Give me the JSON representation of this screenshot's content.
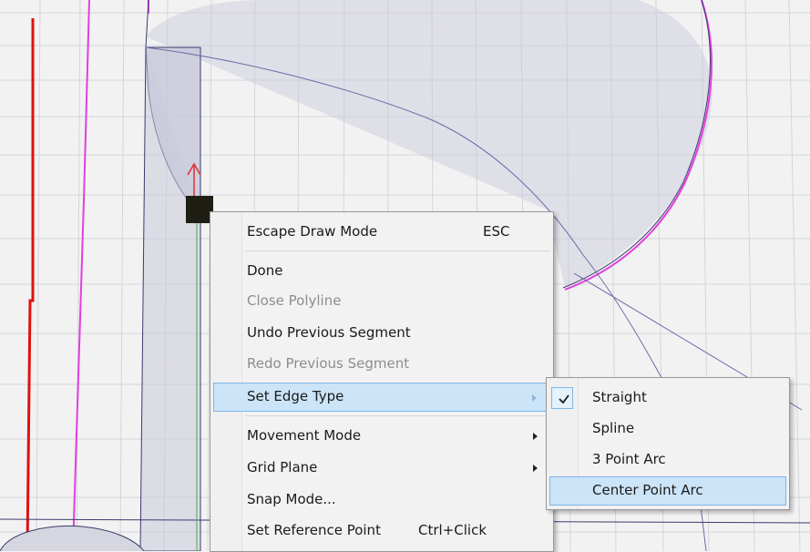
{
  "context_menu": {
    "items": [
      {
        "label": "Escape Draw Mode",
        "shortcut": "ESC"
      },
      {
        "label": "Done"
      },
      {
        "label": "Close Polyline",
        "disabled": true
      },
      {
        "label": "Undo Previous Segment"
      },
      {
        "label": "Redo Previous Segment",
        "disabled": true
      },
      {
        "label": "Set Edge Type",
        "highlighted": true,
        "submenu": true
      },
      {
        "label": "Movement Mode",
        "submenu": true
      },
      {
        "label": "Grid Plane",
        "submenu": true
      },
      {
        "label": "Snap Mode..."
      },
      {
        "label": "Set Reference Point",
        "shortcut": "Ctrl+Click"
      }
    ]
  },
  "submenu": {
    "items": [
      {
        "label": "Straight",
        "checked": true
      },
      {
        "label": "Spline"
      },
      {
        "label": "3 Point Arc"
      },
      {
        "label": "Center Point Arc",
        "highlighted": true
      }
    ]
  },
  "colors": {
    "grid": "#d3d5dc",
    "outline": "#3b3b6e",
    "magenta_curve": "#e23ee0",
    "red_line": "#e01010",
    "fill": "#ccccdc",
    "axis_up": "#e03030"
  }
}
